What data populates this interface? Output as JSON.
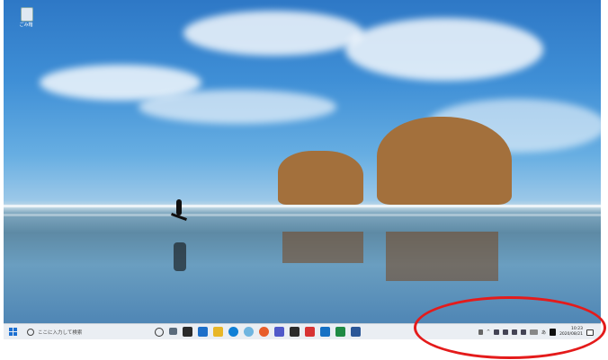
{
  "desktop": {
    "recycle_bin_label": "ごみ箱",
    "wallpaper": "beach-runner-rocks"
  },
  "taskbar": {
    "search_placeholder": "ここに入力して検索",
    "pinned_apps": [
      "cortana-icon",
      "task-view-icon",
      "store-icon",
      "mail-icon",
      "explorer-icon",
      "edge-icon",
      "chrome-icon",
      "firefox-icon",
      "teams-icon",
      "sticky-icon",
      "acrobat-icon",
      "outlook-icon",
      "excel-icon",
      "word-icon"
    ],
    "tray": {
      "time": "10:23",
      "date": "2020/08/21",
      "ime": "あ"
    }
  },
  "annotation": {
    "color": "#e41b1b",
    "shape": "ellipse-around-system-tray"
  }
}
